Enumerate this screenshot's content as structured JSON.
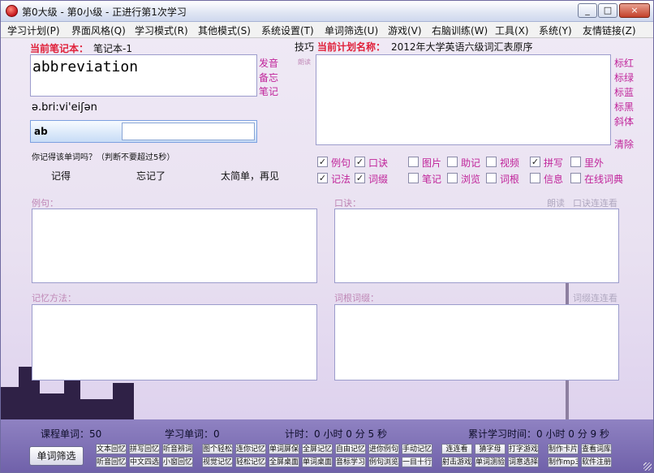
{
  "window": {
    "title": "第0大级 - 第0小级 - 正进行第1次学习",
    "controls": {
      "minimize": "_",
      "restore": "□",
      "close": "×"
    }
  },
  "menu": [
    "学习计划(P)",
    "界面风格(Q)",
    "学习模式(R)",
    "其他模式(S)",
    "系统设置(T)",
    "单词筛选(U)",
    "游戏(V)",
    "右脑训练(W)",
    "工具(X)",
    "系统(Y)",
    "友情链接(Z)"
  ],
  "notebook": {
    "label": "当前笔记本：",
    "value": "笔记本-1"
  },
  "word": {
    "text": "abbreviation",
    "phonetic": "ə.bri:vi'eiʃən",
    "spell_hint": "ab",
    "spell_value": ""
  },
  "word_links": [
    "发音",
    "备忘",
    "笔记"
  ],
  "small_tag": "朗读",
  "question": "你记得该单词吗？（判断不要超过5秒）",
  "answers": [
    "记得",
    "忘记了",
    "太简单，再见"
  ],
  "plan": {
    "tip_label": "技巧",
    "label": "当前计划名称：",
    "value": "2012年大学英语六级词汇表原序"
  },
  "style_links": [
    "标红",
    "标绿",
    "标蓝",
    "标黑",
    "斜体",
    "清除"
  ],
  "checkboxes_row1": [
    {
      "label": "例句",
      "checked": true
    },
    {
      "label": "口诀",
      "checked": true
    },
    {
      "label": "图片",
      "checked": false
    },
    {
      "label": "助记",
      "checked": false
    },
    {
      "label": "视频",
      "checked": false
    },
    {
      "label": "拼写",
      "checked": true
    },
    {
      "label": "里外",
      "checked": false
    }
  ],
  "checkboxes_row2": [
    {
      "label": "记法",
      "checked": true
    },
    {
      "label": "词缀",
      "checked": true
    },
    {
      "label": "笔记",
      "checked": false
    },
    {
      "label": "浏览",
      "checked": false
    },
    {
      "label": "词根",
      "checked": false
    },
    {
      "label": "信息",
      "checked": false
    },
    {
      "label": "在线词典",
      "checked": false
    }
  ],
  "sections": {
    "example": "例句：",
    "mnemonic": "口诀：",
    "memory": "记忆方法：",
    "root": "词根词缀：",
    "read_example": "朗读",
    "mnemonic_link": "口诀连连看",
    "root_link": "词缀连连看"
  },
  "status": {
    "course_words": "课程单词：50",
    "learned_words": "学习单词：0",
    "timer": "计时：0 小时 0 分 5 秒",
    "total_time": "累计学习时间：0 小时 0 分 9 秒"
  },
  "filter_button": "单词筛选",
  "toolbar_row1": [
    "文本回忆",
    "拼写回忆",
    "听音辨词",
    "图个轻松",
    "连你记忆",
    "单词屏保",
    "全屏记忆",
    "自由记忆",
    "进你例句",
    "手动记忆",
    "连连看",
    "猜字母",
    "打字游戏",
    "制作卡片",
    "查看词库"
  ],
  "toolbar_row2": [
    "听音回忆",
    "中文四选",
    "小窗回忆",
    "视觉记忆",
    "轻松记忆",
    "全屏桌面",
    "单词桌面",
    "音标学习",
    "例句浏览",
    "一目十行",
    "射击游戏",
    "单词测验",
    "词意选择",
    "制作mp3",
    "软件注册"
  ]
}
